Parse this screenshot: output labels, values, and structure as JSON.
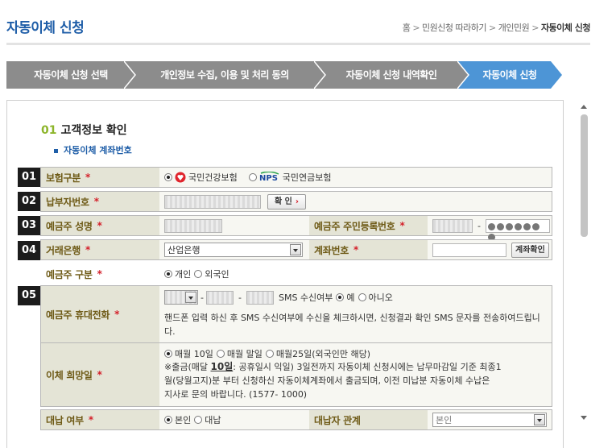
{
  "page": {
    "title": "자동이체 신청",
    "breadcrumb": [
      "홈",
      "민원신청 따라하기",
      "개인민원",
      "자동이체 신청"
    ]
  },
  "steps": [
    {
      "label": "자동이체 신청 선택",
      "active": false
    },
    {
      "label": "개인정보 수집, 이용 및 처리 동의",
      "active": false
    },
    {
      "label": "자동이체 신청 내역확인",
      "active": false
    },
    {
      "label": "자동이체 신청",
      "active": true
    }
  ],
  "section": {
    "number": "01",
    "title": "고객정보 확인",
    "subtitle": "자동이체 계좌번호"
  },
  "colors": {
    "brand_blue": "#1f5ea8",
    "step_gray": "#8c8c8c",
    "step_active": "#4d95d6",
    "label_bg": "#e4e4d6",
    "label_text": "#6e5a16",
    "required": "#d4202a",
    "section_number": "#8db52b"
  },
  "form": {
    "insurance_type": {
      "number": "01",
      "label": "보험구분",
      "required_mark": "*",
      "options": [
        {
          "label": "국민건강보험",
          "selected": true,
          "icon": "nhis-logo-icon"
        },
        {
          "label": "국민연금보험",
          "selected": false,
          "icon": "nps-logo-icon"
        }
      ]
    },
    "payer_number": {
      "number": "02",
      "label": "납부자번호",
      "required_mark": "*",
      "confirm_button": "확 인"
    },
    "depositor": {
      "number": "03",
      "name_label": "예금주 성명",
      "id_label": "예금주 주민등록번호",
      "required_mark": "*",
      "id_separator": "-"
    },
    "bank": {
      "number": "04",
      "bank_label": "거래은행",
      "bank_value": "산업은행",
      "account_label": "계좌번호",
      "account_button": "계좌확인",
      "required_mark": "*"
    },
    "depositor_type": {
      "label": "예금주 구분",
      "required_mark": "*",
      "options": [
        {
          "label": "개인",
          "selected": true
        },
        {
          "label": "외국인",
          "selected": false
        }
      ]
    },
    "mobile": {
      "number": "05",
      "label": "예금주 휴대전화",
      "required_mark": "*",
      "separator": "-",
      "sms_label": "SMS 수신여부",
      "sms_options": [
        {
          "label": "예",
          "selected": true
        },
        {
          "label": "아니오",
          "selected": false
        }
      ],
      "notice": "핸드폰 입력 하신 후 SMS 수신여부에 수신을 체크하시면, 신청결과 확인 SMS 문자를 전송하여드립니다."
    },
    "transfer_date": {
      "label": "이체 희망일",
      "required_mark": "*",
      "options": [
        {
          "label": "매월 10일",
          "selected": true
        },
        {
          "label": "매월 말일",
          "selected": false
        },
        {
          "label": "매월25일(외국인만 해당)",
          "selected": false
        }
      ],
      "notice_prefix": "※출금(매달 ",
      "notice_bold": "10일",
      "notice_line1_rest": ": 공휴일시 익일) 3일전까지 자동이체 신청시에는 납무마감일 기준 최종1",
      "notice_line2": "월(당월고지)분 부터 신청하신 자동이체계좌에서 출금되며, 이전 미납분 자동이체 수납은",
      "notice_line3": "지사로 문의 바랍니다. (1577- 1000)"
    },
    "proxy": {
      "label": "대납 여부",
      "required_mark": "*",
      "options": [
        {
          "label": "본인",
          "selected": true
        },
        {
          "label": "대납",
          "selected": false
        }
      ],
      "relation_label": "대납자 관계",
      "relation_value": "본인"
    }
  }
}
